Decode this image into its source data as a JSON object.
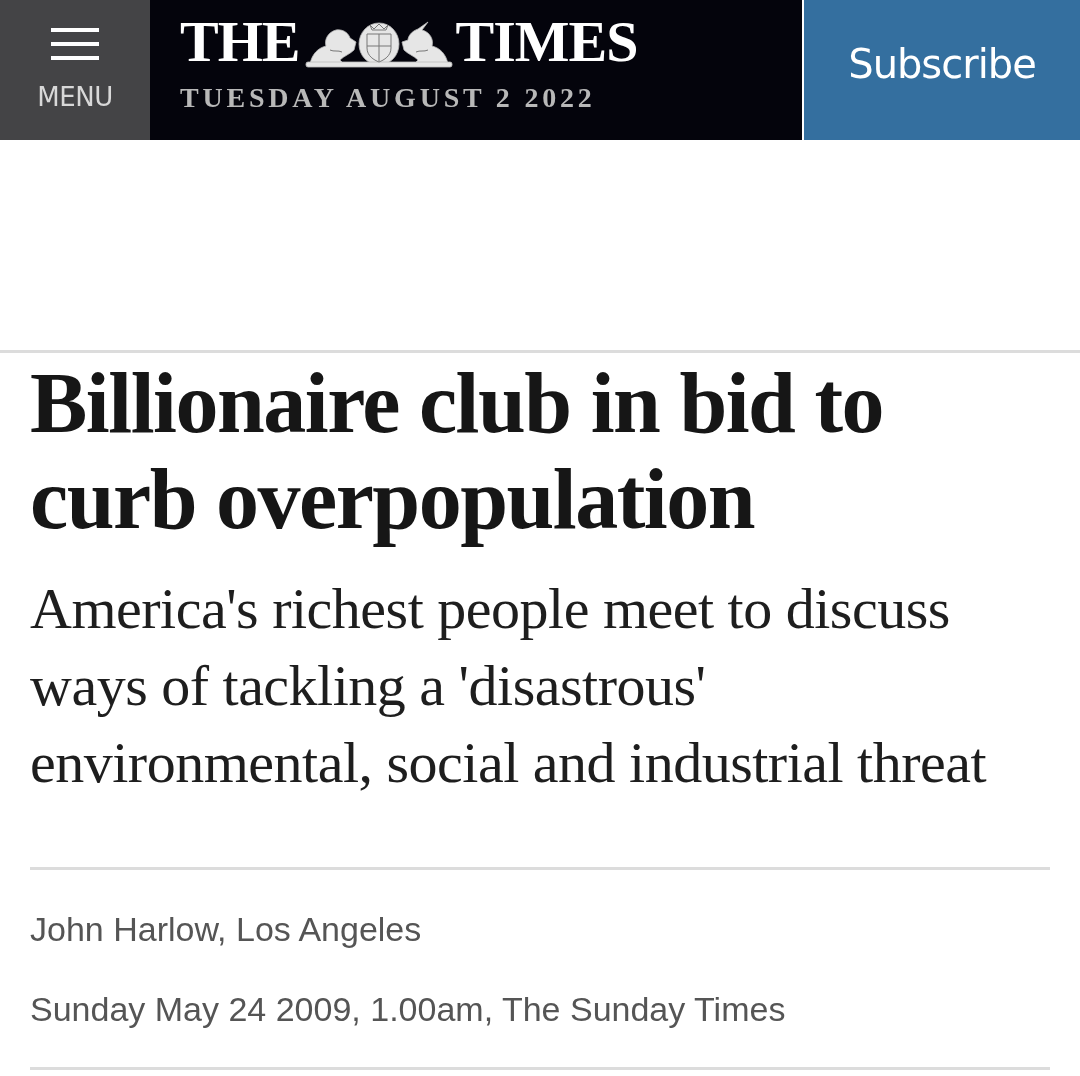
{
  "header": {
    "menu_button": {
      "label": "MENU"
    },
    "logo": {
      "word_1": "THE",
      "word_2": "TIMES"
    },
    "date": "TUESDAY AUGUST 2 2022",
    "subscribe_button": {
      "label": "Subscribe"
    }
  },
  "article": {
    "headline": "Billionaire club in bid to curb overpopulation",
    "standfirst": "America's richest people meet to discuss ways of tackling a 'disastrous' environmental, social and industrial threat",
    "byline": "John Harlow, Los Angeles",
    "dateline": "Sunday May 24 2009, 1.00am, The Sunday Times"
  }
}
